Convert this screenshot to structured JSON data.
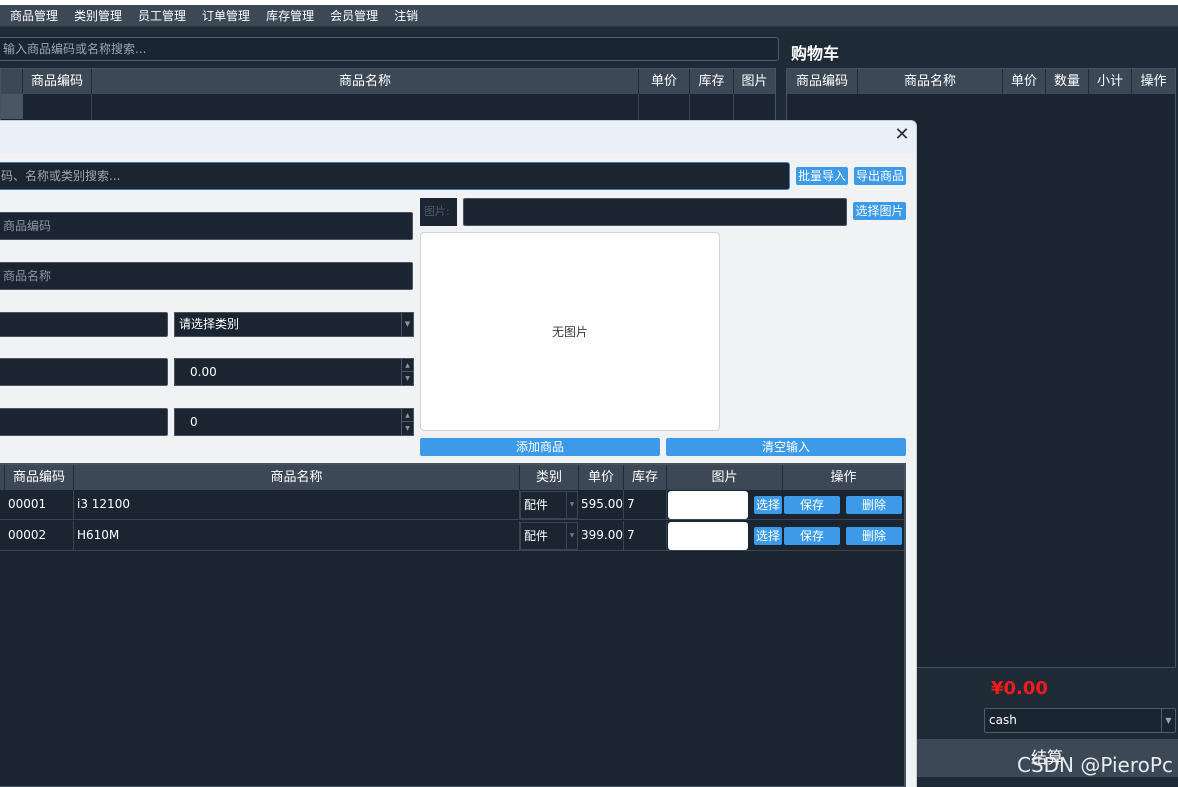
{
  "menu": [
    "商品管理",
    "类别管理",
    "员工管理",
    "订单管理",
    "库存管理",
    "会员管理",
    "注销"
  ],
  "main_search": {
    "placeholder": "输入商品编码或名称搜索..."
  },
  "product_table": {
    "headers": [
      "商品编码",
      "商品名称",
      "单价",
      "库存",
      "图片"
    ]
  },
  "cart": {
    "title": "购物车",
    "headers": [
      "商品编码",
      "商品名称",
      "单价",
      "数量",
      "小计",
      "操作"
    ],
    "total": "¥0.00",
    "payment_method": "cash",
    "checkout_label": "结算"
  },
  "watermark": "CSDN @PieroPc",
  "dialog": {
    "search_placeholder": "码、名称或类别搜索...",
    "import_label": "批量导入",
    "export_label": "导出商品",
    "image_label": "图片:",
    "choose_image_label": "选择图片",
    "code_placeholder": "商品编码",
    "name_placeholder": "商品名称",
    "category_placeholder": "请选择类别",
    "price_value": "0.00",
    "stock_value": "0",
    "no_image_text": "无图片",
    "add_label": "添加商品",
    "clear_label": "清空输入",
    "table_headers": [
      "商品编码",
      "商品名称",
      "类别",
      "单价",
      "库存",
      "图片",
      "操作"
    ],
    "select_label": "选择",
    "save_label": "保存",
    "delete_label": "删除",
    "rows": [
      {
        "code": "00001",
        "name": "i3 12100",
        "category": "配件",
        "price": "595.00",
        "stock": "7"
      },
      {
        "code": "00002",
        "name": "H610M",
        "category": "配件",
        "price": "399.00",
        "stock": "7"
      }
    ]
  },
  "colors": {
    "accent": "#3d9ae8",
    "total": "#ff1a1a",
    "panel": "#1b2531",
    "header": "#3c4856"
  }
}
